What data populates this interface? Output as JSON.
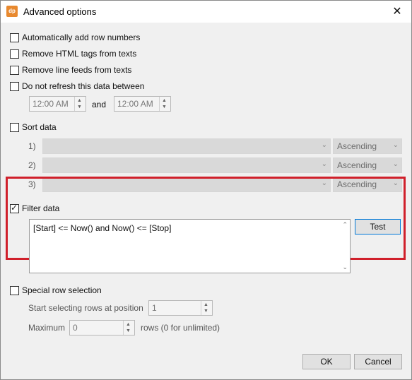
{
  "window": {
    "title": "Advanced options",
    "app_icon_text": "dp",
    "close_glyph": "✕"
  },
  "options": {
    "auto_row_numbers": "Automatically add row numbers",
    "remove_html": "Remove HTML tags from texts",
    "remove_line_feeds": "Remove line feeds from texts",
    "no_refresh": "Do not refresh this data between"
  },
  "refresh_times": {
    "start": "12:00 AM",
    "and_label": "and",
    "end": "12:00 AM"
  },
  "sort": {
    "label": "Sort data",
    "rows": [
      {
        "index": "1)",
        "field": "",
        "order": "Ascending"
      },
      {
        "index": "2)",
        "field": "",
        "order": "Ascending"
      },
      {
        "index": "3)",
        "field": "",
        "order": "Ascending"
      }
    ]
  },
  "filter": {
    "label": "Filter data",
    "checked": true,
    "expression": "[Start] <= Now() and Now() <= [Stop]",
    "test_label": "Test"
  },
  "special": {
    "label": "Special row selection",
    "start_label": "Start selecting rows at position",
    "start_value": "1",
    "max_label": "Maximum",
    "max_value": "0",
    "rows_hint": "rows (0 for unlimited)"
  },
  "footer": {
    "ok": "OK",
    "cancel": "Cancel"
  },
  "icons": {
    "spin_up": "▲",
    "spin_down": "▼",
    "combo_arrow": "⌄",
    "scroll_up": "⌃",
    "scroll_down": "⌄"
  },
  "colors": {
    "highlight": "#d0202b",
    "focus": "#0078d7"
  }
}
